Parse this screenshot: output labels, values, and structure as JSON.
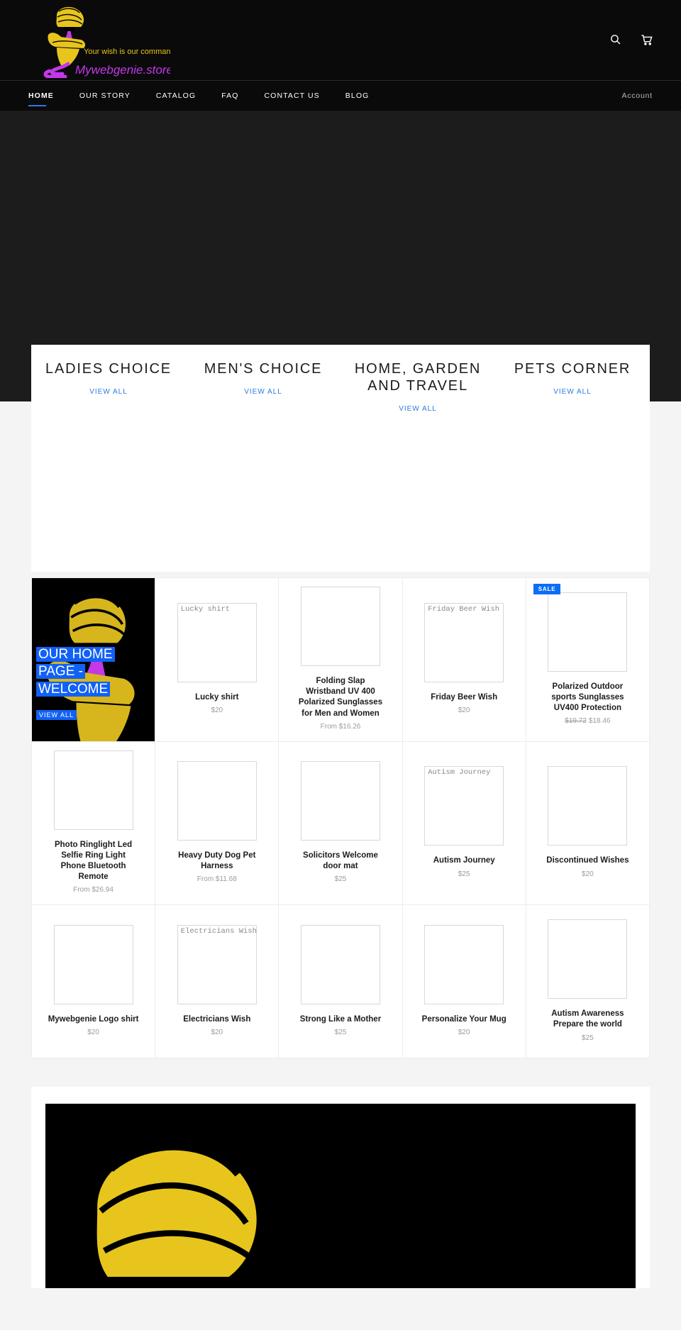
{
  "brand": {
    "name": "Mywebgenie.store",
    "tagline": "Your wish is our command",
    "logo_icon": "genie-logo",
    "colors": {
      "gold": "#e8c51c",
      "magenta": "#c438e8",
      "accent_blue": "#2a7ae2",
      "sale_blue": "#0b6ef5"
    }
  },
  "header": {
    "search_icon": "search-icon",
    "cart_icon": "cart-icon"
  },
  "nav": {
    "items": [
      {
        "label": "HOME",
        "active": true
      },
      {
        "label": "OUR STORY",
        "active": false
      },
      {
        "label": "CATALOG",
        "active": false
      },
      {
        "label": "FAQ",
        "active": false
      },
      {
        "label": "CONTACT US",
        "active": false
      },
      {
        "label": "BLOG",
        "active": false
      }
    ],
    "account_label": "Account"
  },
  "collections": {
    "view_all_label": "VIEW ALL",
    "items": [
      {
        "title": "LADIES CHOICE",
        "link": "VIEW ALL"
      },
      {
        "title": "MEN'S CHOICE",
        "link": "VIEW ALL"
      },
      {
        "title": "HOME, GARDEN AND TRAVEL",
        "link": "VIEW ALL"
      },
      {
        "title": "PETS CORNER",
        "link": "VIEW ALL"
      }
    ]
  },
  "promo": {
    "heading_line1": "OUR HOME",
    "heading_line2": "PAGE -",
    "heading_line3": "WELCOME",
    "link_label": "VIEW ALL"
  },
  "products": [
    {
      "title": "Lucky shirt",
      "price": "$20",
      "alt": "Lucky shirt",
      "show_alt": true,
      "sale": false
    },
    {
      "title": "Folding Slap Wristband UV 400 Polarized Sunglasses for Men and Women",
      "price": "From $16.26",
      "alt": "",
      "show_alt": false,
      "sale": false
    },
    {
      "title": "Friday Beer Wish",
      "price": "$20",
      "alt": "Friday Beer Wish",
      "show_alt": true,
      "sale": false
    },
    {
      "title": "Polarized Outdoor sports Sunglasses UV400 Protection",
      "price": "$18.46",
      "price_was": "$19.72",
      "alt": "",
      "show_alt": false,
      "sale": true,
      "sale_label": "SALE"
    },
    {
      "title": "Photo Ringlight Led Selfie Ring Light Phone Bluetooth Remote",
      "price": "From $26.94",
      "alt": "",
      "show_alt": false,
      "sale": false
    },
    {
      "title": "Heavy Duty Dog Pet Harness",
      "price": "From $11.68",
      "alt": "",
      "show_alt": false,
      "sale": false
    },
    {
      "title": "Solicitors Welcome door mat",
      "price": "$25",
      "alt": "",
      "show_alt": false,
      "sale": false
    },
    {
      "title": "Autism Journey",
      "price": "$25",
      "alt": "Autism Journey",
      "show_alt": true,
      "sale": false
    },
    {
      "title": "Discontinued Wishes",
      "price": "$20",
      "alt": "",
      "show_alt": false,
      "sale": false
    },
    {
      "title": "Mywebgenie Logo shirt",
      "price": "$20",
      "alt": "",
      "show_alt": false,
      "sale": false
    },
    {
      "title": "Electricians Wish",
      "price": "$20",
      "alt": "Electricians Wish",
      "show_alt": true,
      "sale": false
    },
    {
      "title": "Strong Like a Mother",
      "price": "$25",
      "alt": "",
      "show_alt": false,
      "sale": false
    },
    {
      "title": "Personalize Your Mug",
      "price": "$20",
      "alt": "",
      "show_alt": false,
      "sale": false
    },
    {
      "title": "Autism Awareness Prepare the world",
      "price": "$25",
      "alt": "",
      "show_alt": false,
      "sale": false
    }
  ]
}
